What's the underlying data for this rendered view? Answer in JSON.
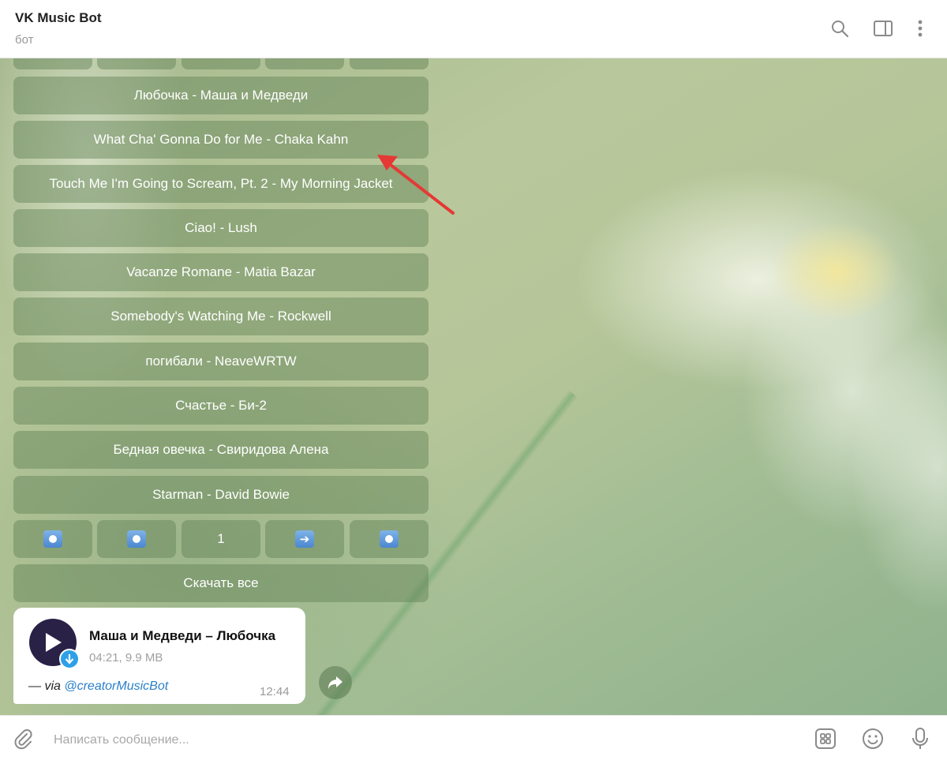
{
  "header": {
    "title": "VK Music Bot",
    "subtitle": "бот",
    "icons": [
      "search-icon",
      "sidebar-toggle-icon",
      "more-vertical-icon"
    ]
  },
  "keyboard": {
    "tracks": [
      "Любочка - Маша и Медведи",
      "What Cha' Gonna Do for Me - Chaka Kahn",
      "Touch Me I'm Going to Scream, Pt. 2 - My Morning Jacket",
      "Ciao! - Lush",
      "Vacanze Romane - Matia Bazar",
      "Somebody's Watching Me - Rockwell",
      "погибали - NeaveWRTW",
      "Счастье - Би-2",
      "Бедная овечка - Свиридова Алена",
      "Starman - David Bowie"
    ],
    "nav": {
      "page": "1",
      "icons": [
        "record-button-icon",
        "record-button-icon",
        "right-arrow-icon",
        "record-button-icon"
      ]
    },
    "download_all": "Скачать все"
  },
  "message": {
    "title": "Маша и Медведи – Любочка",
    "meta": "04:21, 9.9 MB",
    "via_prefix": "— via ",
    "via_bot": "@creatorMusicBot",
    "time": "12:44"
  },
  "input": {
    "placeholder": "Написать сообщение..."
  },
  "colors": {
    "accent": "#2ea0e8",
    "keyboard_button": "#608054",
    "annotation_arrow": "#e53935"
  }
}
